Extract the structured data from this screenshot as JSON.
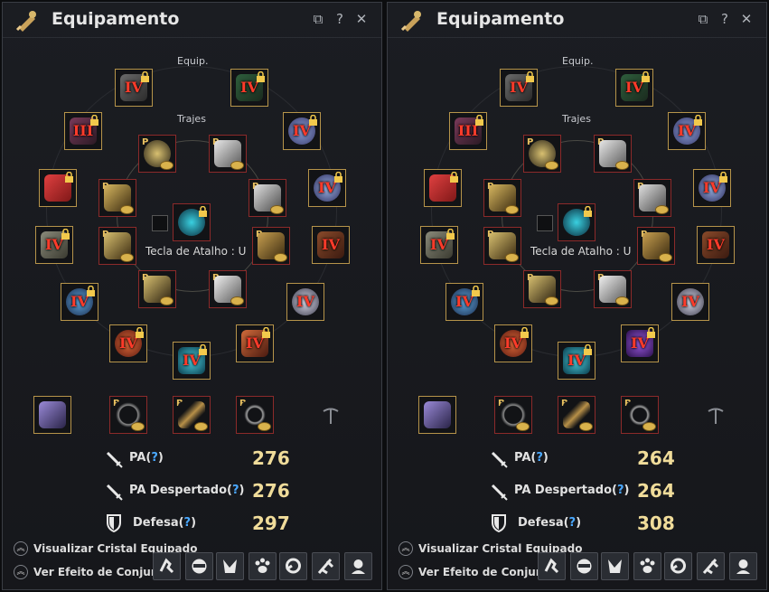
{
  "panels": [
    {
      "title": "Equipamento",
      "sections": {
        "equip": "Equip.",
        "outfits": "Trajes"
      },
      "hotkey": "Tecla de Atalho : U",
      "stats": {
        "ap_label": "PA",
        "ap_value": "276",
        "awakening_label": "PA Despertado",
        "awakening_value": "276",
        "defense_label": "Defesa",
        "defense_value": "297",
        "help_mark": "?"
      },
      "links": {
        "crystals": "Visualizar Cristal Equipado",
        "set_effect": "Ver Efeito de Conjunto"
      },
      "grades": {
        "helmet": "IV",
        "chest": "IV",
        "gloves_l": "III",
        "gloves_r": "IV",
        "ring1": "IV",
        "belt": "IV",
        "earring1": "IV",
        "earring2": "IV",
        "necklace": "IV",
        "shoes": "IV",
        "weapon": "IV",
        "offhand": "IV"
      }
    },
    {
      "title": "Equipamento",
      "sections": {
        "equip": "Equip.",
        "outfits": "Trajes"
      },
      "hotkey": "Tecla de Atalho : U",
      "stats": {
        "ap_label": "PA",
        "ap_value": "264",
        "awakening_label": "PA Despertado",
        "awakening_value": "264",
        "defense_label": "Defesa",
        "defense_value": "308",
        "help_mark": "?"
      },
      "links": {
        "crystals": "Visualizar Cristal Equipado",
        "set_effect": "Ver Efeito de Conjunto"
      },
      "grades": {
        "helmet": "IV",
        "chest": "IV",
        "gloves_l": "III",
        "gloves_r": "IV",
        "ring1": "IV",
        "belt": "IV",
        "earring1": "IV",
        "earring2": "IV",
        "necklace": "IV",
        "shoes": "IV",
        "weapon": "IV",
        "offhand": "IV"
      }
    }
  ],
  "icons": [
    "title-bag-icon",
    "copy-icon",
    "help-icon",
    "close-icon",
    "lock-icon",
    "sword-icon",
    "shield-icon",
    "pickaxe-icon",
    "chevron-up-icon"
  ],
  "colors": {
    "grade": "#ff3b2a",
    "stat_value": "#f0dc9a",
    "help_mark": "#4aa8ff",
    "gold_border": "#b6944a",
    "red_border": "#8c2a2a"
  }
}
